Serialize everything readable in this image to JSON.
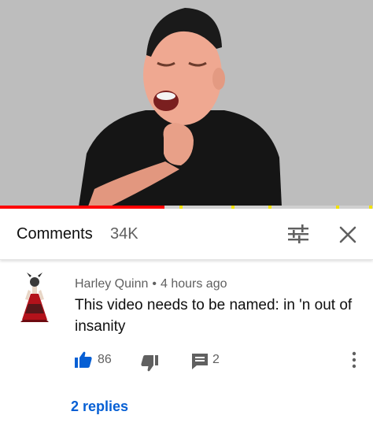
{
  "video": {
    "progress_percent": 44,
    "ad_marker_percents": [
      48,
      62,
      72,
      90,
      99
    ]
  },
  "comments_header": {
    "title": "Comments",
    "count": "34K"
  },
  "icons": {
    "sort": "sort-icon",
    "close": "close-icon",
    "like": "thumbs-up-icon",
    "dislike": "thumbs-down-icon",
    "reply": "reply-icon",
    "more": "more-vert-icon"
  },
  "comment": {
    "author": "Harley Quinn",
    "separator": "•",
    "time": "4 hours ago",
    "text": "This video needs to be named: in 'n out of insanity",
    "likes": "86",
    "replies_count": "2",
    "replies_link": "2 replies"
  },
  "colors": {
    "accent_blue": "#065fd4",
    "like_blue": "#065fd4",
    "progress_red": "#ff0000",
    "ad_marker_yellow": "#f2e200",
    "secondary_text": "#606060"
  }
}
